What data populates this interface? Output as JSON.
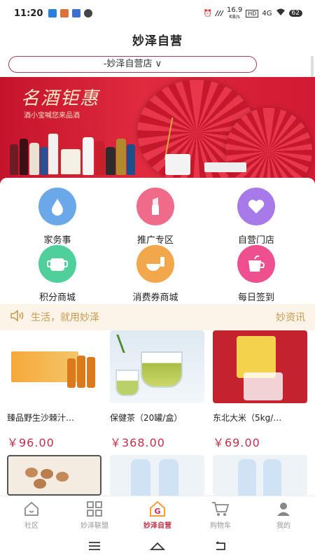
{
  "status_bar": {
    "time": "11:20",
    "network_speed": "16.9",
    "network_unit": "KB/s",
    "signal": "4G",
    "battery": "62"
  },
  "page_title": "妙泽自营",
  "store_selector": "-妙泽自营店 ∨",
  "banner": {
    "title": "名酒钜惠",
    "subtitle": "酒小宝喊您来品酒"
  },
  "categories": [
    {
      "label": "家务事",
      "icon": "water-drop-icon",
      "color": "#6aa8ea"
    },
    {
      "label": "推广专区",
      "icon": "lipstick-icon",
      "color": "#f06a8a"
    },
    {
      "label": "自营门店",
      "icon": "heart-icon",
      "color": "#a67ae8"
    },
    {
      "label": "积分商城",
      "icon": "cup-icon",
      "color": "#4fcf9a"
    },
    {
      "label": "消费券商城",
      "icon": "bowl-icon",
      "color": "#f2a84a"
    },
    {
      "label": "每日签到",
      "icon": "checkin-cup-icon",
      "color": "#ee4f8e"
    }
  ],
  "notice": {
    "text": "生活，就用妙泽",
    "more": "妙资讯"
  },
  "products": [
    {
      "name": "臻品野生沙棘汁…",
      "price": "￥96.00"
    },
    {
      "name": "保健茶（20罐/盒）",
      "price": "￥368.00"
    },
    {
      "name": "东北大米（5kg/…",
      "price": "￥69.00"
    }
  ],
  "tabbar": [
    {
      "label": "社区",
      "icon": "home-icon"
    },
    {
      "label": "妙泽联盟",
      "icon": "grid-icon"
    },
    {
      "label": "妙泽自营",
      "icon": "store-icon",
      "active": true
    },
    {
      "label": "购物车",
      "icon": "cart-icon"
    },
    {
      "label": "我的",
      "icon": "user-icon"
    }
  ],
  "colors": {
    "accent": "#c0304a",
    "gold": "#c89a4c"
  }
}
